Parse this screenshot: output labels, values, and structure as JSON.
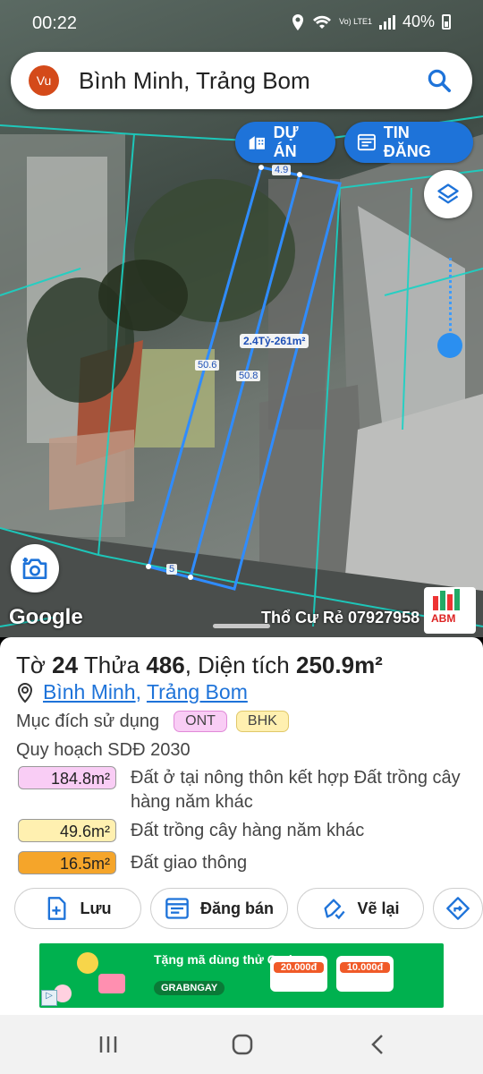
{
  "status_bar": {
    "time": "00:22",
    "network": "Vo) LTE1",
    "battery": "40%"
  },
  "search": {
    "avatar": "Vu",
    "title": "Bình Minh, Trảng Bom",
    "icon": "search-icon"
  },
  "map_buttons": {
    "project": "DỰ ÁN",
    "listing": "TIN ĐĂNG"
  },
  "map_labels": {
    "edge_top": "4.9",
    "edge_left": "50.6",
    "edge_right": "50.8",
    "edge_bottom": "5",
    "price": "2.4Tỷ-261m²",
    "google": "Google",
    "ad_text": "Thổ Cư Rẻ 07927958",
    "abm": "ABM"
  },
  "parcel": {
    "sheet_label": "Tờ",
    "sheet": "24",
    "parcel_label": "Thửa",
    "parcel": "486",
    "area_label": ", Diện tích",
    "area": "250.9m²",
    "ward": "Bình Minh",
    "separator": ",",
    "district": "Trảng Bom",
    "purpose_label": "Mục đích sử dụng",
    "tags": [
      {
        "code": "ONT",
        "bg": "#f9cdf5",
        "border": "#e08ad8"
      },
      {
        "code": "BHK",
        "bg": "#fff0b0",
        "border": "#e0c86a"
      }
    ],
    "planning_label": "Quy hoạch SDĐ 2030",
    "zones": [
      {
        "area": "184.8m²",
        "desc": "Đất ở tại nông thôn kết hợp Đất trồng cây hàng năm khác",
        "color": "#f9cdf5"
      },
      {
        "area": "49.6m²",
        "desc": "Đất trồng cây hàng năm khác",
        "color": "#fff0b0"
      },
      {
        "area": "16.5m²",
        "desc": "Đất giao thông",
        "color": "#f5a52a"
      }
    ]
  },
  "actions": {
    "save": "Lưu",
    "post": "Đăng bán",
    "redraw": "Vẽ lại"
  },
  "ad": {
    "headline": "Tặng mã dùng thử Grab",
    "cta": "GRABNGAY",
    "coupon1": "20.000đ",
    "coupon2": "10.000đ"
  },
  "colors": {
    "accent": "#1e73d9",
    "parcel_line": "#2f8cff",
    "boundary": "#19d3c5"
  }
}
